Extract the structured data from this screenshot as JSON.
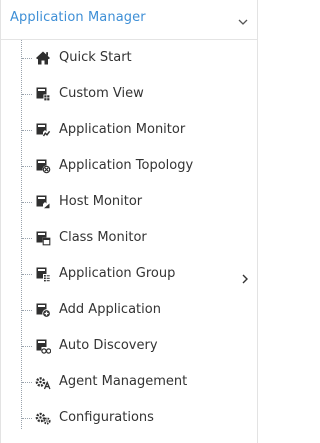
{
  "header": {
    "title": "Application Manager",
    "chevron_icon": "chevron-down-icon"
  },
  "menu": {
    "items": [
      {
        "label": "Quick Start",
        "icon": "home-icon"
      },
      {
        "label": "Custom View",
        "icon": "custom-view-icon"
      },
      {
        "label": "Application Monitor",
        "icon": "application-monitor-icon"
      },
      {
        "label": "Application Topology",
        "icon": "application-topology-icon"
      },
      {
        "label": "Host Monitor",
        "icon": "host-monitor-icon"
      },
      {
        "label": "Class Monitor",
        "icon": "class-monitor-icon"
      },
      {
        "label": "Application Group",
        "icon": "application-group-icon",
        "has_submenu": true
      },
      {
        "label": "Add Application",
        "icon": "add-application-icon"
      },
      {
        "label": "Auto Discovery",
        "icon": "auto-discovery-icon"
      },
      {
        "label": "Agent Management",
        "icon": "agent-management-icon"
      },
      {
        "label": "Configurations",
        "icon": "configurations-icon"
      }
    ]
  },
  "colors": {
    "accent": "#3e8fd6",
    "text": "#333333",
    "icon": "#2f2f2f",
    "tree_line": "#9aa3ad"
  }
}
